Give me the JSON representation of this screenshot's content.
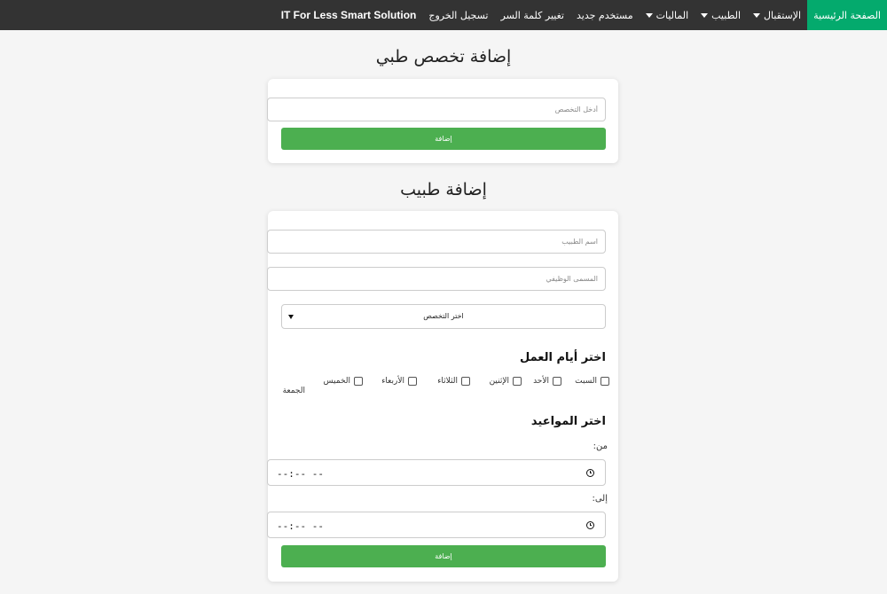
{
  "navbar": {
    "home": "الصفحة الرئيسية",
    "reception": "الإستقبال",
    "doctor": "الطبيب",
    "finance": "الماليات",
    "new_user": "مستخدم جديد",
    "change_password": "تغيير كلمة السر",
    "logout": "تسجيل الخروج",
    "brand": "IT For Less Smart Solution",
    "accent_color": "#04aa6d"
  },
  "specialty_section": {
    "title": "إضافة تخصص طبي",
    "input_placeholder": "أدخل التخصص",
    "button_label": "إضافة"
  },
  "doctor_section": {
    "title": "إضافة طبيب",
    "name_placeholder": "اسم الطبيب",
    "job_title_placeholder": "المسمى الوظيفي",
    "specialty_select": "اختر التخصص",
    "days_heading": "اختر أيام العمل",
    "days": [
      "السبت",
      "الأحد",
      "الإثنين",
      "الثلاثاء",
      "الأربعاء",
      "الخميس",
      "الجمعة"
    ],
    "appointments_heading": "اختر المواعيد",
    "from_label": "من:",
    "to_label": "إلى:",
    "from_value": "--:-- --",
    "to_value": "--:-- --",
    "button_label": "إضافة"
  }
}
